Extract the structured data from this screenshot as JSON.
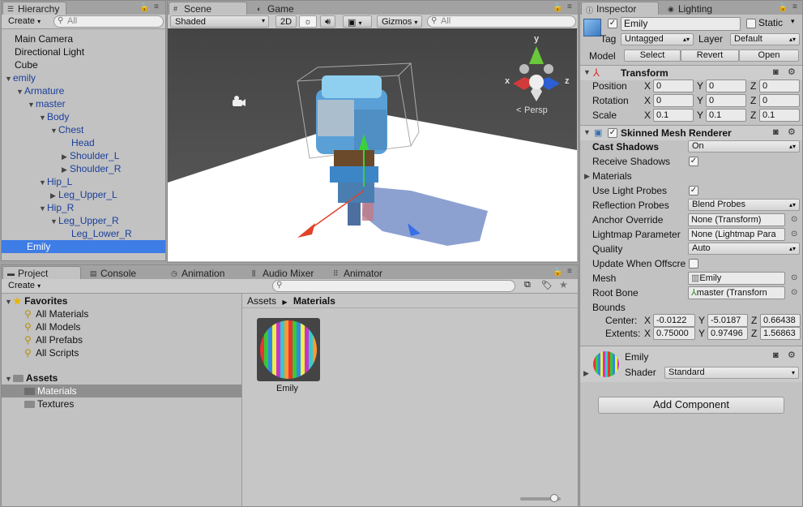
{
  "hierarchy": {
    "tab": "Hierarchy",
    "create": "Create",
    "search_placeholder": "All",
    "items": [
      {
        "label": "Main Camera"
      },
      {
        "label": "Directional Light"
      },
      {
        "label": "Cube"
      },
      {
        "label": "emily"
      },
      {
        "label": "Armature"
      },
      {
        "label": "master"
      },
      {
        "label": "Body"
      },
      {
        "label": "Chest"
      },
      {
        "label": "Head"
      },
      {
        "label": "Shoulder_L"
      },
      {
        "label": "Shoulder_R"
      },
      {
        "label": "Hip_L"
      },
      {
        "label": "Leg_Upper_L"
      },
      {
        "label": "Hip_R"
      },
      {
        "label": "Leg_Upper_R"
      },
      {
        "label": "Leg_Lower_R"
      },
      {
        "label": "Emily"
      }
    ]
  },
  "scene": {
    "tabs": [
      "Scene",
      "Game"
    ],
    "shading": "Shaded",
    "mode_2d": "2D",
    "gizmos": "Gizmos",
    "search_placeholder": "All",
    "persp": "Persp",
    "gizmo_y": "y",
    "gizmo_x": "x",
    "gizmo_z": "z"
  },
  "inspector": {
    "tabs": [
      "Inspector",
      "Lighting"
    ],
    "name": "Emily",
    "static_label": "Static",
    "tag_label": "Tag",
    "tag_value": "Untagged",
    "layer_label": "Layer",
    "layer_value": "Default",
    "model_label": "Model",
    "model_buttons": [
      "Select",
      "Revert",
      "Open"
    ],
    "transform": {
      "title": "Transform",
      "rows": [
        {
          "label": "Position",
          "x": "0",
          "y": "0",
          "z": "0"
        },
        {
          "label": "Rotation",
          "x": "0",
          "y": "0",
          "z": "0"
        },
        {
          "label": "Scale",
          "x": "0.1",
          "y": "0.1",
          "z": "0.1"
        }
      ]
    },
    "smr": {
      "title": "Skinned Mesh Renderer",
      "cast_shadows_label": "Cast Shadows",
      "cast_shadows_value": "On",
      "receive_shadows": "Receive Shadows",
      "materials": "Materials",
      "use_light_probes": "Use Light Probes",
      "reflection_probes_label": "Reflection Probes",
      "reflection_probes_value": "Blend Probes",
      "anchor_override_label": "Anchor Override",
      "anchor_override_value": "None (Transform)",
      "lightmap_label": "Lightmap Parameter",
      "lightmap_value": "None (Lightmap Para",
      "quality_label": "Quality",
      "quality_value": "Auto",
      "update_offscreen": "Update When Offscre",
      "mesh_label": "Mesh",
      "mesh_value": "Emily",
      "root_bone_label": "Root Bone",
      "root_bone_value": "master (Transforn",
      "bounds_label": "Bounds",
      "center_label": "Center:",
      "center": {
        "x": "-0.0122",
        "y": "-5.0187",
        "z": "0.66438"
      },
      "extents_label": "Extents:",
      "extents": {
        "x": "0.75000",
        "y": "0.97496",
        "z": "1.56863"
      }
    },
    "material": {
      "name": "Emily",
      "shader_label": "Shader",
      "shader_value": "Standard"
    },
    "add_component": "Add Component",
    "axes": {
      "x": "X",
      "y": "Y",
      "z": "Z"
    }
  },
  "project": {
    "tabs": [
      "Project",
      "Console",
      "Animation",
      "Audio Mixer",
      "Animator"
    ],
    "create": "Create",
    "favorites_label": "Favorites",
    "favorites": [
      "All Materials",
      "All Models",
      "All Prefabs",
      "All Scripts"
    ],
    "assets_label": "Assets",
    "folders": [
      "Materials",
      "Textures"
    ],
    "breadcrumb": [
      "Assets",
      "Materials"
    ],
    "asset_name": "Emily"
  },
  "colors": {
    "selection": "#3e7ce6",
    "panel": "#c2c2c2",
    "prefab_blue": "#1a3f9b"
  }
}
